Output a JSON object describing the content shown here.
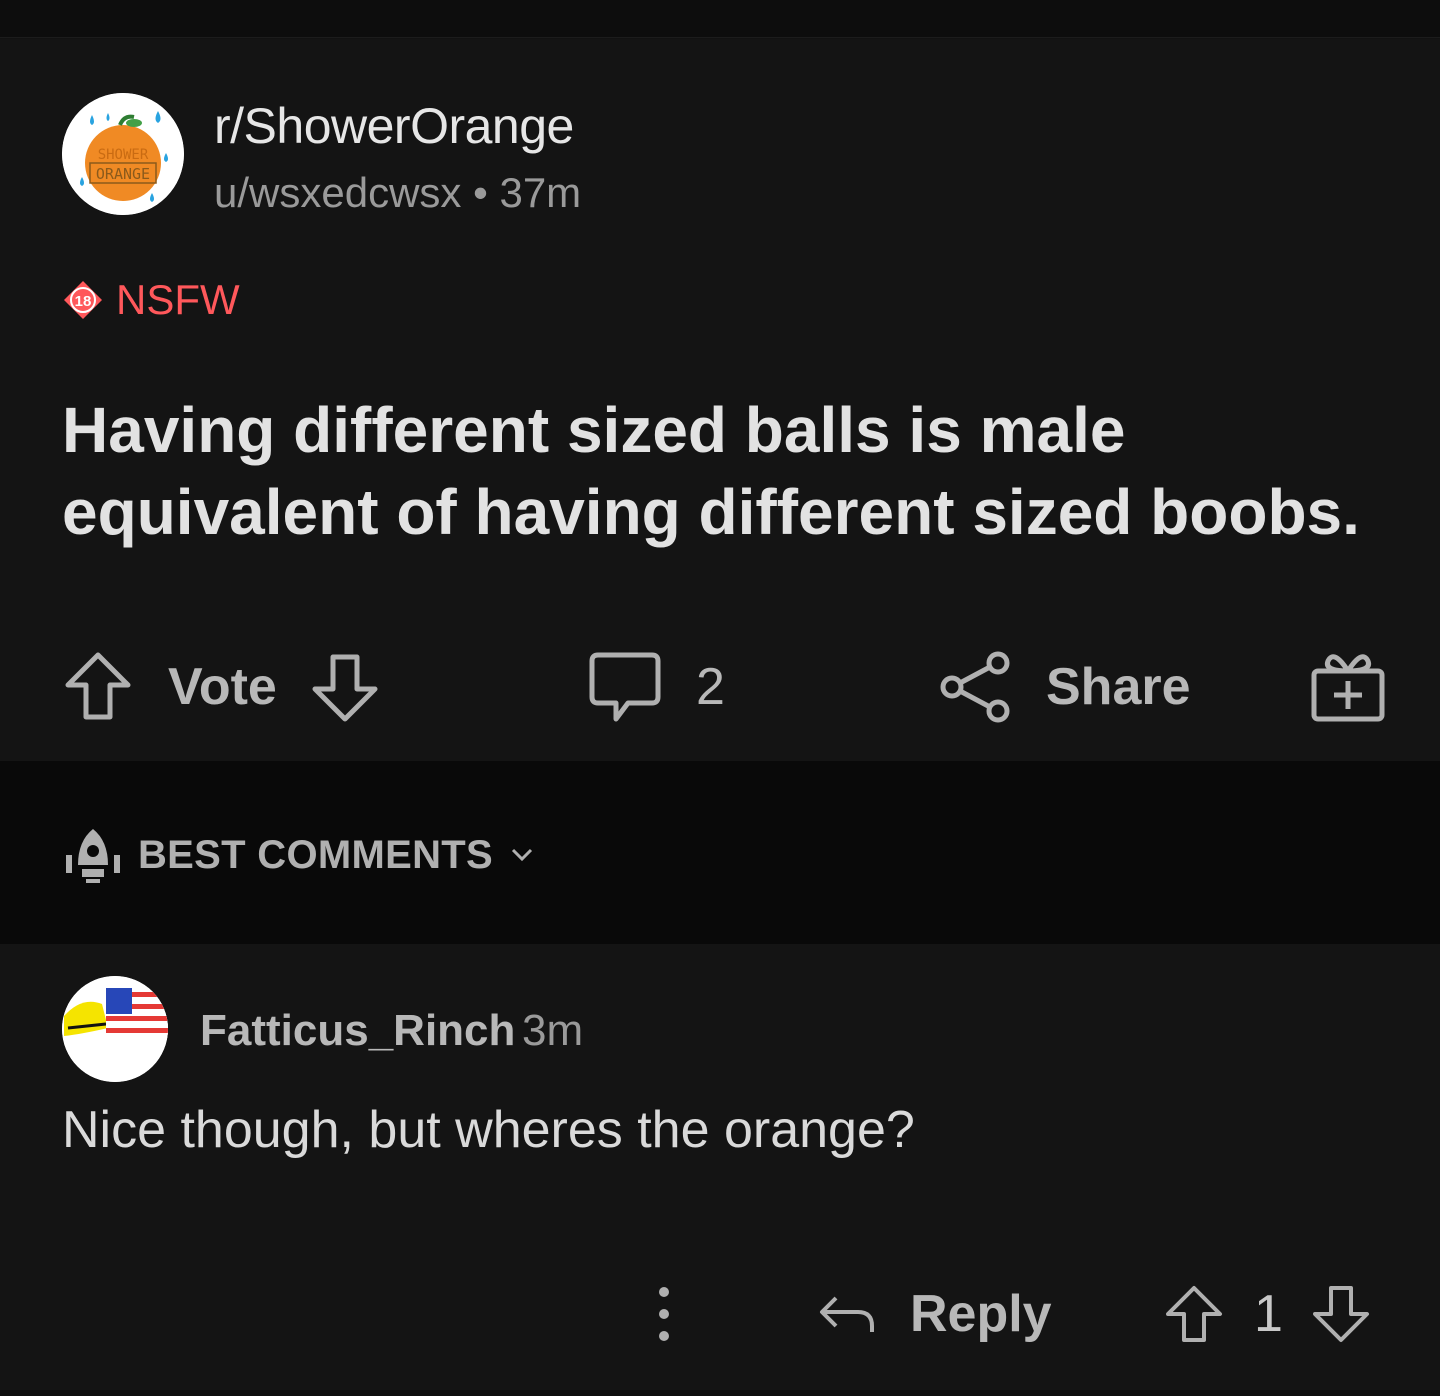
{
  "post": {
    "subreddit": "r/ShowerOrange",
    "subreddit_icon_text_1": "SHOWER",
    "subreddit_icon_text_2": "ORANGE",
    "author": "u/wsxedcwsx",
    "separator": "•",
    "age": "37m",
    "nsfw_badge_number": "18",
    "nsfw_label": "NSFW",
    "title": "Having different sized balls is male equivalent of having different sized boobs.",
    "vote_label": "Vote",
    "comment_count": "2",
    "share_label": "Share"
  },
  "sort": {
    "label": "BEST COMMENTS"
  },
  "comment": {
    "author": "Fatticus_Rinch",
    "age": "3m",
    "body": "Nice though, but wheres the orange?",
    "reply_label": "Reply",
    "score": "1"
  },
  "colors": {
    "background": "#121212",
    "nsfw": "#ff585b",
    "orange": "#f08a24"
  }
}
